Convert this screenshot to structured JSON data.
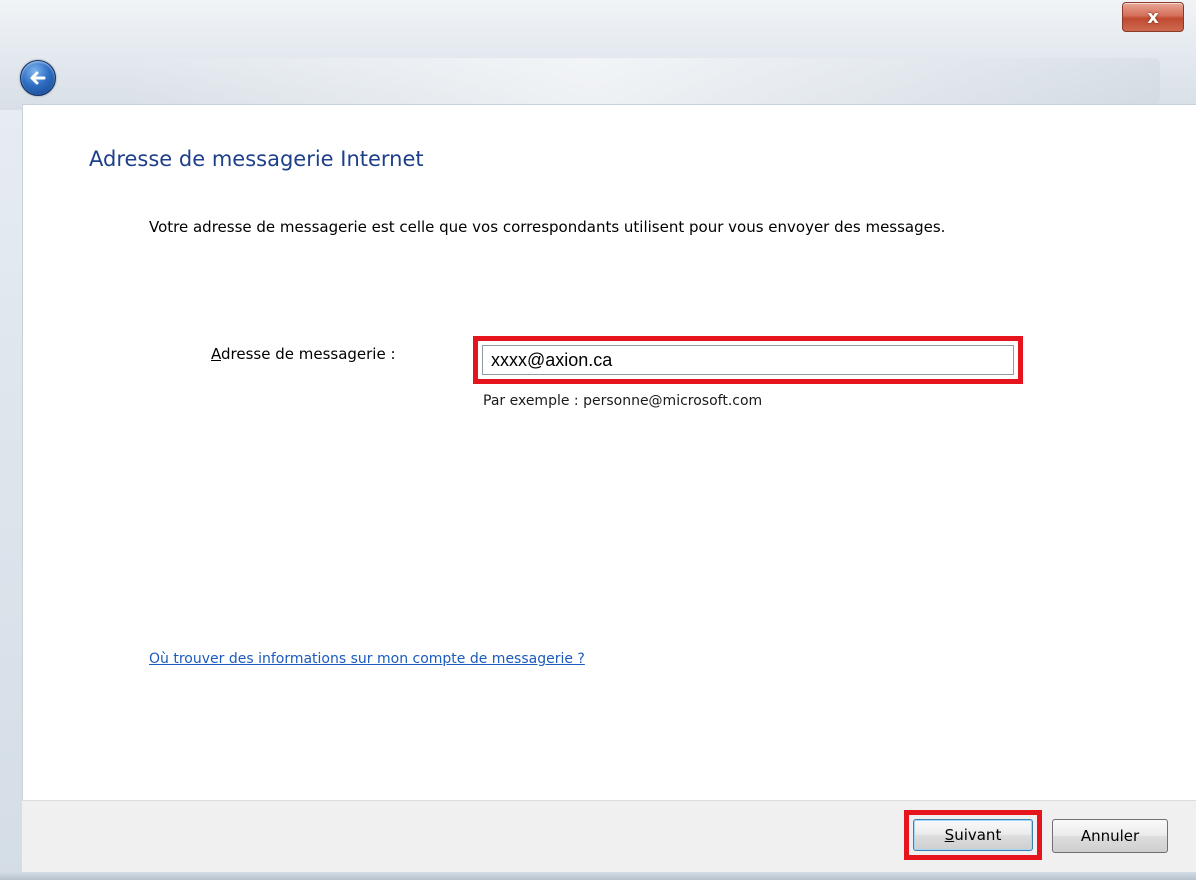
{
  "window": {
    "close_label": "x"
  },
  "page": {
    "title": "Adresse de messagerie Internet",
    "intro": "Votre adresse de messagerie est celle que vos correspondants utilisent pour vous envoyer des messages."
  },
  "email_field": {
    "label_first": "A",
    "label_rest": "dresse de messagerie :",
    "value": "xxxx@axion.ca",
    "example": "Par exemple : personne@microsoft.com"
  },
  "help_link": "Où trouver des informations sur mon compte de messagerie ?",
  "footer": {
    "next_first": "S",
    "next_rest": "uivant",
    "cancel_label": "Annuler"
  },
  "colors": {
    "title": "#1e3f8a",
    "link": "#1a5bbd",
    "highlight": "#e5141d"
  },
  "icons": {
    "back": "back-arrow-icon",
    "close": "close-icon"
  }
}
